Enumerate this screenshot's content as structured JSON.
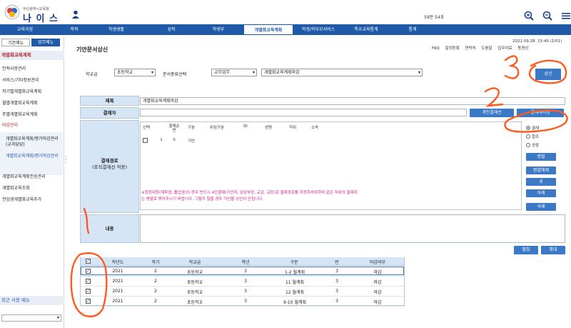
{
  "header": {
    "org": "부산광역시교육청",
    "brand": "나 이 스",
    "timer": "59분 54초"
  },
  "nav": [
    "교육과정",
    "학적",
    "학생생활",
    "성적",
    "학생부",
    "개별화교육계획",
    "학생/학부모서비스",
    "특수교육통계",
    "통계"
  ],
  "sidebar": {
    "tab_basic": "기본메뉴",
    "tab_work": "업무메뉴",
    "section": "개별화교육계획",
    "items": [
      "인적사항관리",
      "서비스/기타정보관리",
      "학기별개별화교육계획",
      "월별개별화교육계획",
      "주별개별화교육계획",
      "마감관리"
    ],
    "sub_items": [
      "개별화교육계획/평가마감관리(교과담당)",
      "개별화교육계획/평가마감관리"
    ],
    "items2": [
      "개별화교육계획전송관리",
      "개별화교육조회",
      "전입생개별화교육추가"
    ],
    "recent": "최근 사용 메뉴"
  },
  "page": {
    "title": "기안문서상신",
    "date": "2021.09.28. 15:40 (1/01)",
    "tools": [
      "FAQ",
      "질의등록",
      "연락처",
      "도움말",
      "업무자료",
      "동영상"
    ]
  },
  "filters": {
    "school_level_label": "학교급",
    "school_level_value": "초등학교",
    "doc_type_label": "문서종류선택",
    "doc_type_value": "교무업무",
    "doc_kind_value": "개별화교육계획마감",
    "submit_button": "상신"
  },
  "form": {
    "title_label": "제목",
    "title_value": "개별화교육계획마감",
    "approver_label": "결재자",
    "personal_approval_btn": "개인결재선",
    "set_approver_btn": "결재자지정",
    "route_label": "결재경로",
    "route_sub": "(조직결재선 적용)",
    "content_label": "내용",
    "ap_headers": [
      "선택",
      "결재순번",
      "구분",
      "위임구분",
      "ID",
      "성명",
      "직위",
      "소속"
    ],
    "ap_row": [
      "",
      "1",
      "0",
      "기안",
      "",
      "",
      "",
      ""
    ],
    "notice_line1": "※정정대장(재학생, 졸업생)의 경우 반드시 4단결재(기안자, 담당부장, 교감, 교장)로 결재경로를 지정하셔야하며 같은 직위의 결재자",
    "notice_line2": "는 병렬로 묶어주시기 바랍니다. 그렇지 않을 경우 기안을 상신이 안됩니다.",
    "radios": [
      "결재",
      "협조",
      "공람"
    ],
    "side_buttons": [
      "병렬",
      "병렬해제",
      "위",
      "아래",
      "삭제"
    ],
    "expand_btn": "확대",
    "collapse_btn": "펼침"
  },
  "grid": {
    "headers": [
      "학년도",
      "학기",
      "학교급",
      "학년",
      "구분",
      "반",
      "마감여부"
    ],
    "rows": [
      [
        "2021",
        "2",
        "초등학교",
        "3",
        "1-2 월계획",
        "3",
        "마감"
      ],
      [
        "2021",
        "2",
        "초등학교",
        "3",
        "11 월계획",
        "3",
        "마감"
      ],
      [
        "2021",
        "2",
        "초등학교",
        "3",
        "12 월계획",
        "3",
        "마감"
      ],
      [
        "2021",
        "2",
        "초등학교",
        "3",
        "9-10 월계획",
        "3",
        "마감"
      ]
    ]
  },
  "colors": {
    "nav": "#1f5aa8",
    "button": "#3b78c6",
    "annotation": "#ff5a1f",
    "notice": "#d01b8f"
  }
}
